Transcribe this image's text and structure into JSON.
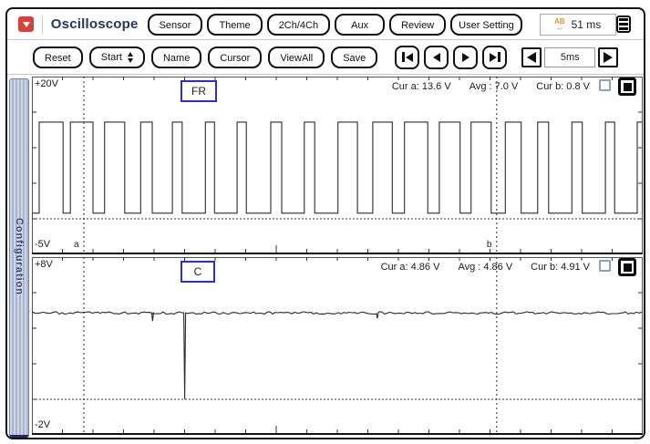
{
  "toolbar_top": {
    "app_title": "Oscilloscope",
    "buttons": [
      "Sensor",
      "Theme",
      "2Ch/4Ch",
      "Aux",
      "Review",
      "User Setting"
    ],
    "time_display": "51 ms"
  },
  "toolbar_controls": {
    "buttons": [
      "Reset",
      "Start",
      "Name",
      "Cursor",
      "ViewAll",
      "Save"
    ],
    "playback": [
      "skip-to-start",
      "step-back",
      "play-forward",
      "skip-to-end"
    ],
    "timebase": {
      "value": "5ms"
    }
  },
  "sidebar": {
    "tab": "Configuration"
  },
  "icons": {
    "logo": "red-dropdown-logo",
    "time_ab": "AB",
    "time_arrows": "↔",
    "menu": "menu-list-icon"
  },
  "colors": {
    "accent_blue": "#2b2be0",
    "logo_red": "#d9423b",
    "icon_orange": "#d69a2d",
    "sidebar_navy": "#33477a",
    "waveform": "#2b2b2b"
  },
  "chart_data": [
    {
      "type": "line",
      "channel_label": "FR",
      "y_top_label": "+20V",
      "y_bottom_label": "-5V",
      "ylim": [
        -5,
        20
      ],
      "xdivisions": 20,
      "ydivisions": 5,
      "grid": false,
      "zero_line_v": 0,
      "measurements": {
        "cur_a": "Cur a: 13.6 V",
        "avg": "Avg : 7.0 V",
        "cur_b": "Cur b: 0.8 V"
      },
      "cursors": {
        "a": 0.085,
        "b": 0.761
      },
      "cursor_labels": {
        "a": "a",
        "b": "b"
      },
      "toggles": {
        "secondary": false,
        "primary": true
      },
      "waveform": {
        "kind": "pwm",
        "high_v": 13.6,
        "low_v": 0.8,
        "pulses": [
          [
            0.012,
            0.051
          ],
          [
            0.063,
            0.1
          ],
          [
            0.119,
            0.152
          ],
          [
            0.178,
            0.197
          ],
          [
            0.23,
            0.246
          ],
          [
            0.284,
            0.299
          ],
          [
            0.336,
            0.351
          ],
          [
            0.391,
            0.409
          ],
          [
            0.446,
            0.463
          ],
          [
            0.501,
            0.533
          ],
          [
            0.558,
            0.59
          ],
          [
            0.61,
            0.648
          ],
          [
            0.667,
            0.701
          ],
          [
            0.719,
            0.752
          ],
          [
            0.775,
            0.801
          ],
          [
            0.828,
            0.846
          ],
          [
            0.884,
            0.901
          ],
          [
            0.939,
            0.954
          ],
          [
            0.991,
            1.0
          ]
        ]
      }
    },
    {
      "type": "line",
      "channel_label": "C",
      "y_top_label": "+8V",
      "y_bottom_label": "-2V",
      "ylim": [
        -2,
        8
      ],
      "xdivisions": 20,
      "ydivisions": 5,
      "grid": false,
      "zero_line_v": 0,
      "measurements": {
        "cur_a": "Cur a: 4.86 V",
        "avg": "Avg : 4.86 V",
        "cur_b": "Cur b: 4.91 V"
      },
      "cursors": {
        "a": 0.085,
        "b": 0.761
      },
      "toggles": {
        "secondary": false,
        "primary": true
      },
      "waveform": {
        "kind": "flat",
        "base_v": 4.86,
        "noise_v": 0.07,
        "spikes": [
          {
            "x": 0.197,
            "v": 4.4
          },
          {
            "x": 0.2495,
            "v": 0.0
          },
          {
            "x": 0.565,
            "v": 4.55
          }
        ]
      }
    }
  ]
}
